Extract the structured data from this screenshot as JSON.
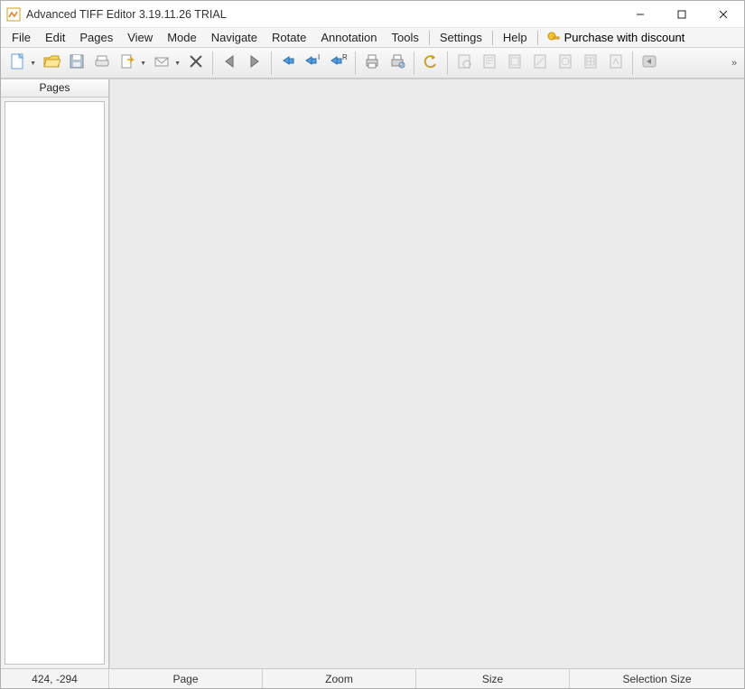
{
  "titlebar": {
    "title": "Advanced TIFF Editor 3.19.11.26 TRIAL"
  },
  "menu": {
    "items": [
      "File",
      "Edit",
      "Pages",
      "View",
      "Mode",
      "Navigate",
      "Rotate",
      "Annotation",
      "Tools"
    ],
    "right_items": [
      "Settings",
      "Help"
    ],
    "purchase": "Purchase with discount"
  },
  "sidebar": {
    "header": "Pages"
  },
  "statusbar": {
    "coords": "424, -294",
    "page": "Page",
    "zoom": "Zoom",
    "size": "Size",
    "selection": "Selection Size"
  },
  "toolbar_icons": [
    "new-doc",
    "open",
    "save",
    "scan",
    "send-dropdown",
    "mail",
    "delete",
    "sep",
    "prev",
    "next",
    "sep",
    "rotate-left",
    "rotate-i",
    "rotate-r",
    "sep",
    "print",
    "print-preview",
    "sep",
    "undo",
    "sep",
    "page-first",
    "page-prev",
    "page-next",
    "page-last",
    "zoom-in",
    "zoom-out",
    "zoom-fit",
    "sep",
    "back-grey"
  ]
}
